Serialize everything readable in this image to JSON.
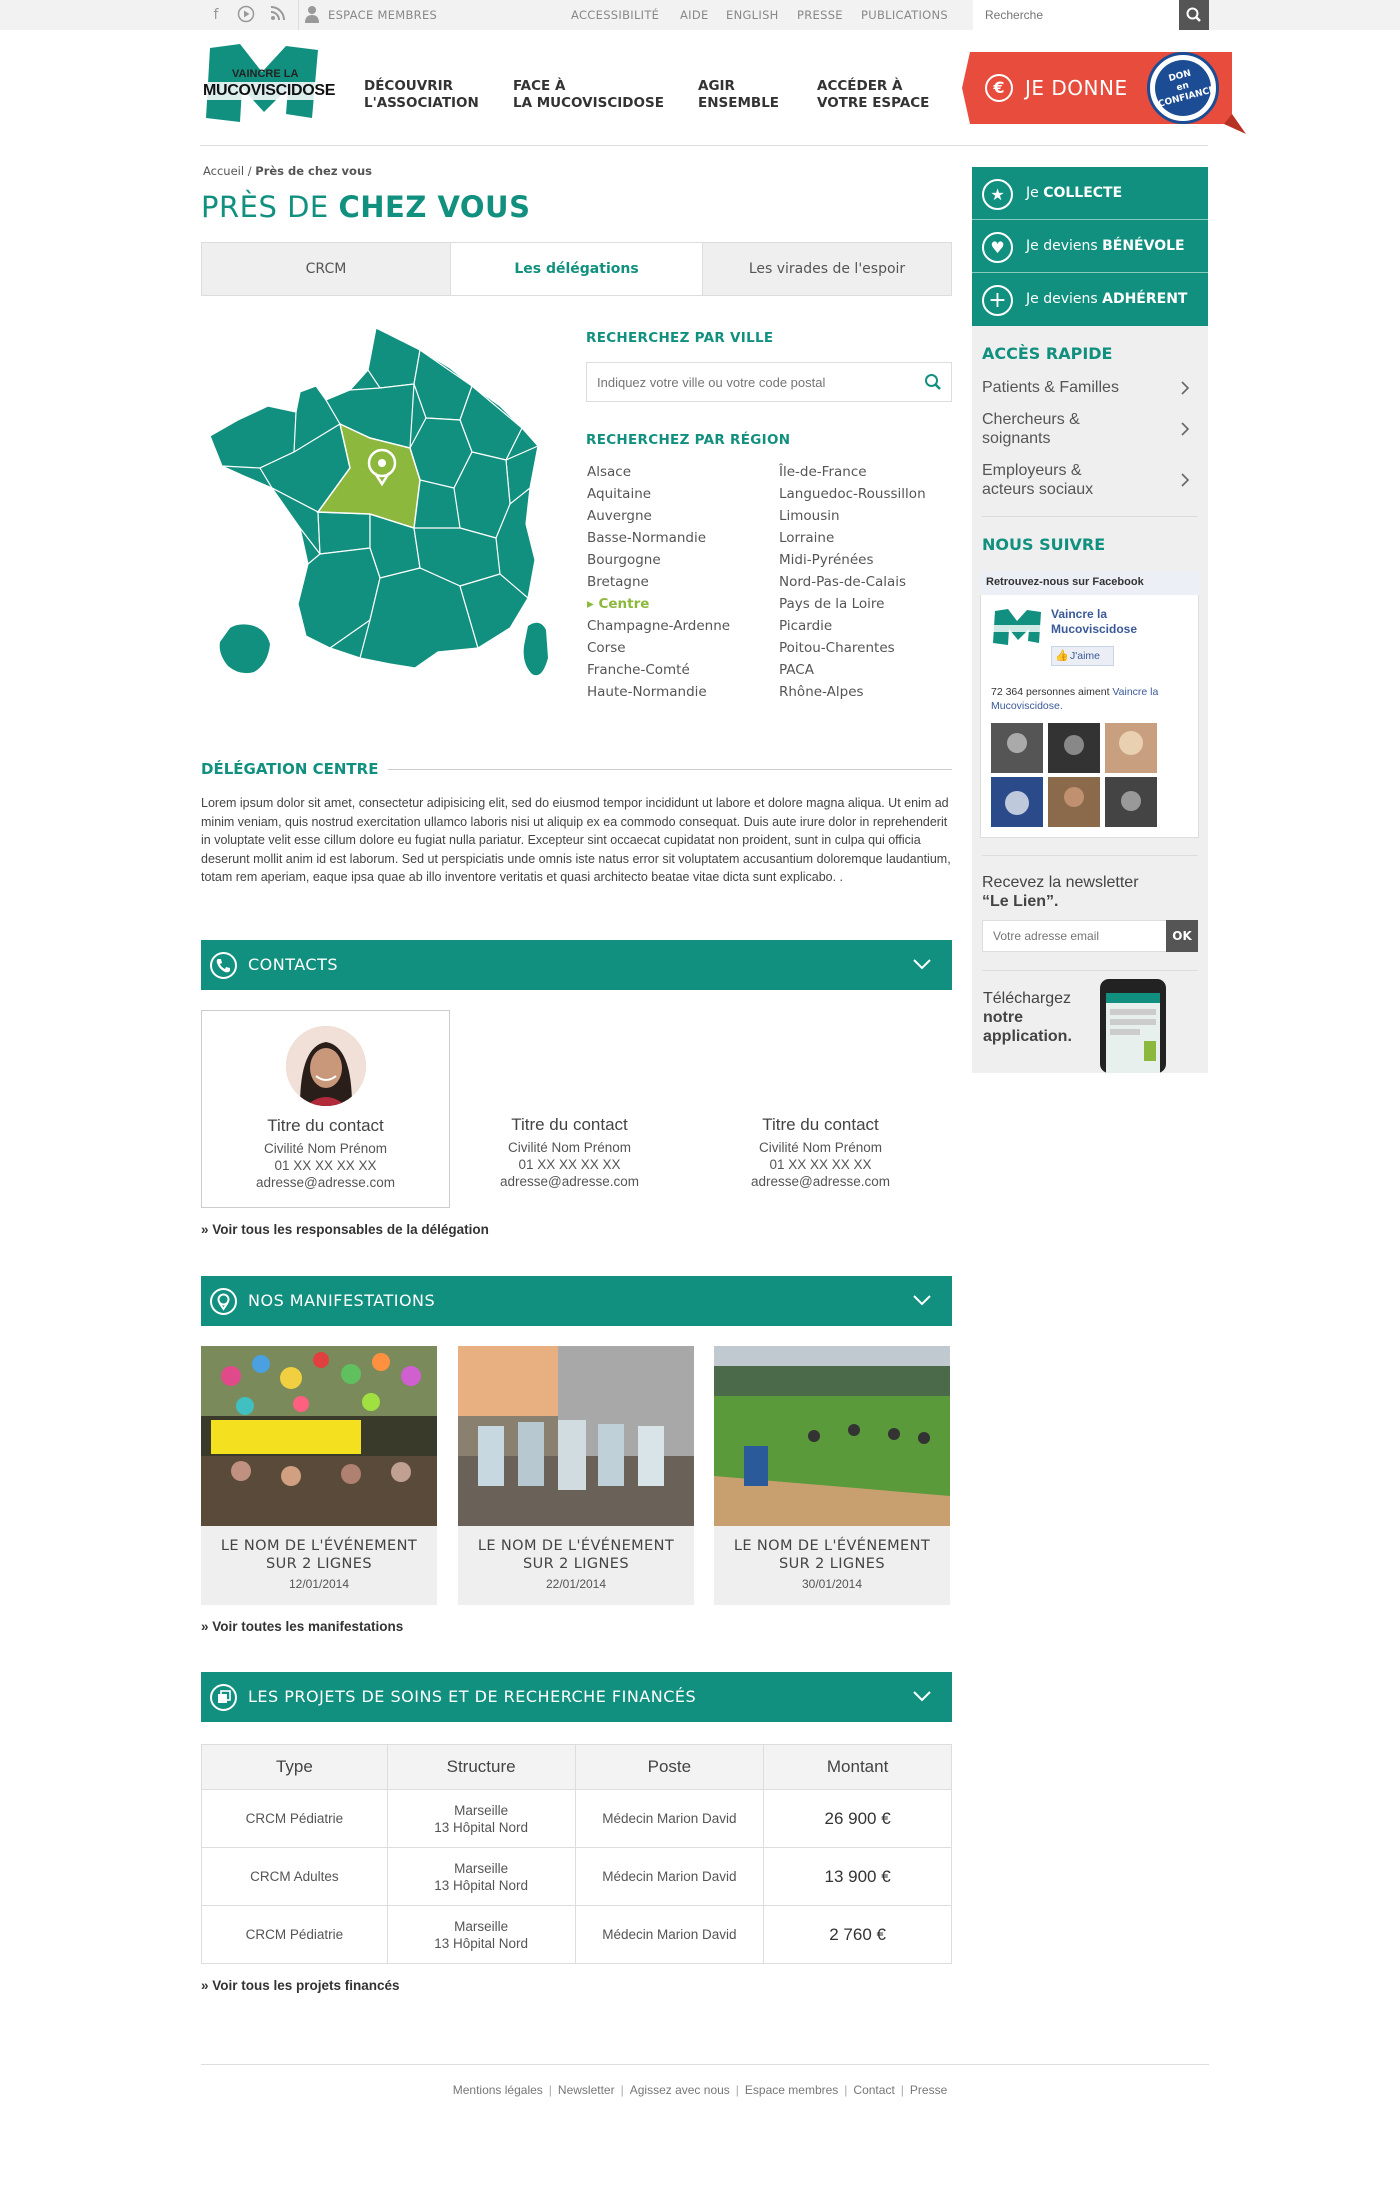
{
  "topbar": {
    "members_label": "ESPACE MEMBRES",
    "links": [
      "ACCESSIBILITÉ",
      "AIDE",
      "ENGLISH",
      "PRESSE",
      "PUBLICATIONS"
    ],
    "search_placeholder": "Recherche"
  },
  "header": {
    "logo_text": [
      "VAINCRE LA",
      "MUCOVISCIDOSE"
    ],
    "nav": [
      {
        "line1": "DÉCOUVRIR",
        "line2": "L'ASSOCIATION"
      },
      {
        "line1": "FACE À",
        "line2": "LA MUCOVISCIDOSE"
      },
      {
        "line1": "AGIR",
        "line2": "ENSEMBLE"
      },
      {
        "line1": "ACCÉDER À",
        "line2": "VOTRE ESPACE"
      }
    ],
    "donate_label": "JE DONNE",
    "donate_badge": [
      "DON",
      "en",
      "CONFIANCE"
    ]
  },
  "breadcrumb": {
    "home": "Accueil",
    "sep": "/",
    "current": "Près de chez vous"
  },
  "page_title": {
    "light": "PRÈS DE",
    "bold": "CHEZ VOUS"
  },
  "tabs": [
    "CRCM",
    "Les délégations",
    "Les virades de l'espoir"
  ],
  "search_city": {
    "label": "RECHERCHEZ PAR VILLE",
    "placeholder": "Indiquez votre ville ou votre code postal"
  },
  "search_region": {
    "label": "RECHERCHEZ PAR RÉGION",
    "col1": [
      "Alsace",
      "Aquitaine",
      "Auvergne",
      "Basse-Normandie",
      "Bourgogne",
      "Bretagne",
      "Centre",
      "Champagne-Ardenne",
      "Corse",
      "Franche-Comté",
      "Haute-Normandie"
    ],
    "col2": [
      "Île-de-France",
      "Languedoc-Roussillon",
      "Limousin",
      "Lorraine",
      "Midi-Pyrénées",
      "Nord-Pas-de-Calais",
      "Pays de la Loire",
      "Picardie",
      "Poitou-Charentes",
      "PACA",
      "Rhône-Alpes"
    ],
    "active": "Centre"
  },
  "delegation": {
    "title_light": "DÉLÉGATION",
    "title_bold": "CENTRE",
    "text": "Lorem ipsum dolor sit amet, consectetur adipisicing elit, sed do eiusmod tempor incididunt ut labore et dolore magna aliqua. Ut enim ad minim veniam, quis nostrud exercitation ullamco laboris nisi ut aliquip ex ea commodo consequat. Duis aute irure dolor in reprehenderit in voluptate velit esse cillum dolore eu fugiat nulla pariatur. Excepteur sint occaecat cupidatat non proident, sunt in culpa qui officia deserunt mollit anim id est laborum. Sed ut perspiciatis unde omnis iste natus error sit voluptatem accusantium doloremque laudantium, totam rem aperiam, eaque ipsa quae ab illo inventore veritatis et quasi architecto beatae vitae dicta sunt explicabo. ."
  },
  "contacts": {
    "bar_label": "CONTACTS",
    "items": [
      {
        "title": "Titre du contact",
        "name": "Civilité Nom Prénom",
        "phone": "01 XX XX XX XX",
        "email": "adresse@adresse.com"
      },
      {
        "title": "Titre du contact",
        "name": "Civilité Nom Prénom",
        "phone": "01 XX XX XX XX",
        "email": "adresse@adresse.com"
      },
      {
        "title": "Titre du contact",
        "name": "Civilité Nom Prénom",
        "phone": "01 XX XX XX XX",
        "email": "adresse@adresse.com"
      }
    ],
    "more_link": "» Voir tous les responsables de la délégation"
  },
  "events": {
    "bar_label": "NOS MANIFESTATIONS",
    "items": [
      {
        "title": "LE NOM DE L'ÉVÉNEMENT SUR 2 LIGNES",
        "date": "12/01/2014"
      },
      {
        "title": "LE NOM DE L'ÉVÉNEMENT SUR 2 LIGNES",
        "date": "22/01/2014"
      },
      {
        "title": "LE NOM DE L'ÉVÉNEMENT SUR 2 LIGNES",
        "date": "30/01/2014"
      }
    ],
    "more_link": "» Voir toutes les manifestations"
  },
  "projects": {
    "bar_label": "LES PROJETS DE SOINS ET DE RECHERCHE FINANCÉS",
    "columns": [
      "Type",
      "Structure",
      "Poste",
      "Montant"
    ],
    "rows": [
      {
        "type": "CRCM Pédiatrie",
        "structure_1": "Marseille",
        "structure_2": "13 Hôpital Nord",
        "poste": "Médecin Marion David",
        "montant": "26 900 €"
      },
      {
        "type": "CRCM Adultes",
        "structure_1": "Marseille",
        "structure_2": "13 Hôpital Nord",
        "poste": "Médecin Marion David",
        "montant": "13 900 €"
      },
      {
        "type": "CRCM Pédiatrie",
        "structure_1": "Marseille",
        "structure_2": "13 Hôpital Nord",
        "poste": "Médecin Marion David",
        "montant": "2 760 €"
      }
    ],
    "more_link": "» Voir tous les projets financés"
  },
  "sidebar": {
    "cta": [
      {
        "light": "Je",
        "bold": "COLLECTE",
        "icon": "star-icon"
      },
      {
        "light": "Je deviens",
        "bold": "BÉNÉVOLE",
        "icon": "heart-icon"
      },
      {
        "light": "Je deviens",
        "bold": "ADHÉRENT",
        "icon": "plus-icon"
      }
    ],
    "quick_title": "ACCÈS RAPIDE",
    "quick_links": [
      [
        "Patients & Familles"
      ],
      [
        "Chercheurs &",
        "soignants"
      ],
      [
        "Employeurs &",
        "acteurs sociaux"
      ]
    ],
    "follow_title": "NOUS SUIVRE",
    "facebook": {
      "header": "Retrouvez-nous sur Facebook",
      "page_name_1": "Vaincre la",
      "page_name_2": "Mucoviscidose",
      "like": "J'aime",
      "count_text": "72 364 personnes aiment",
      "count_link_1": "Vaincre la",
      "count_link_2": "Mucoviscidose."
    },
    "newsletter": {
      "line1": "Recevez la newsletter",
      "line2": "“Le Lien”.",
      "placeholder": "Votre adresse email",
      "button": "OK"
    },
    "app": [
      "Téléchargez",
      "notre",
      "application."
    ]
  },
  "footer": [
    "Mentions légales",
    "Newsletter",
    "Agissez avec nous",
    "Espace membres",
    "Contact",
    "Presse"
  ],
  "colors": {
    "teal": "#11907f",
    "green": "#8db83e",
    "red": "#e74c3c"
  }
}
